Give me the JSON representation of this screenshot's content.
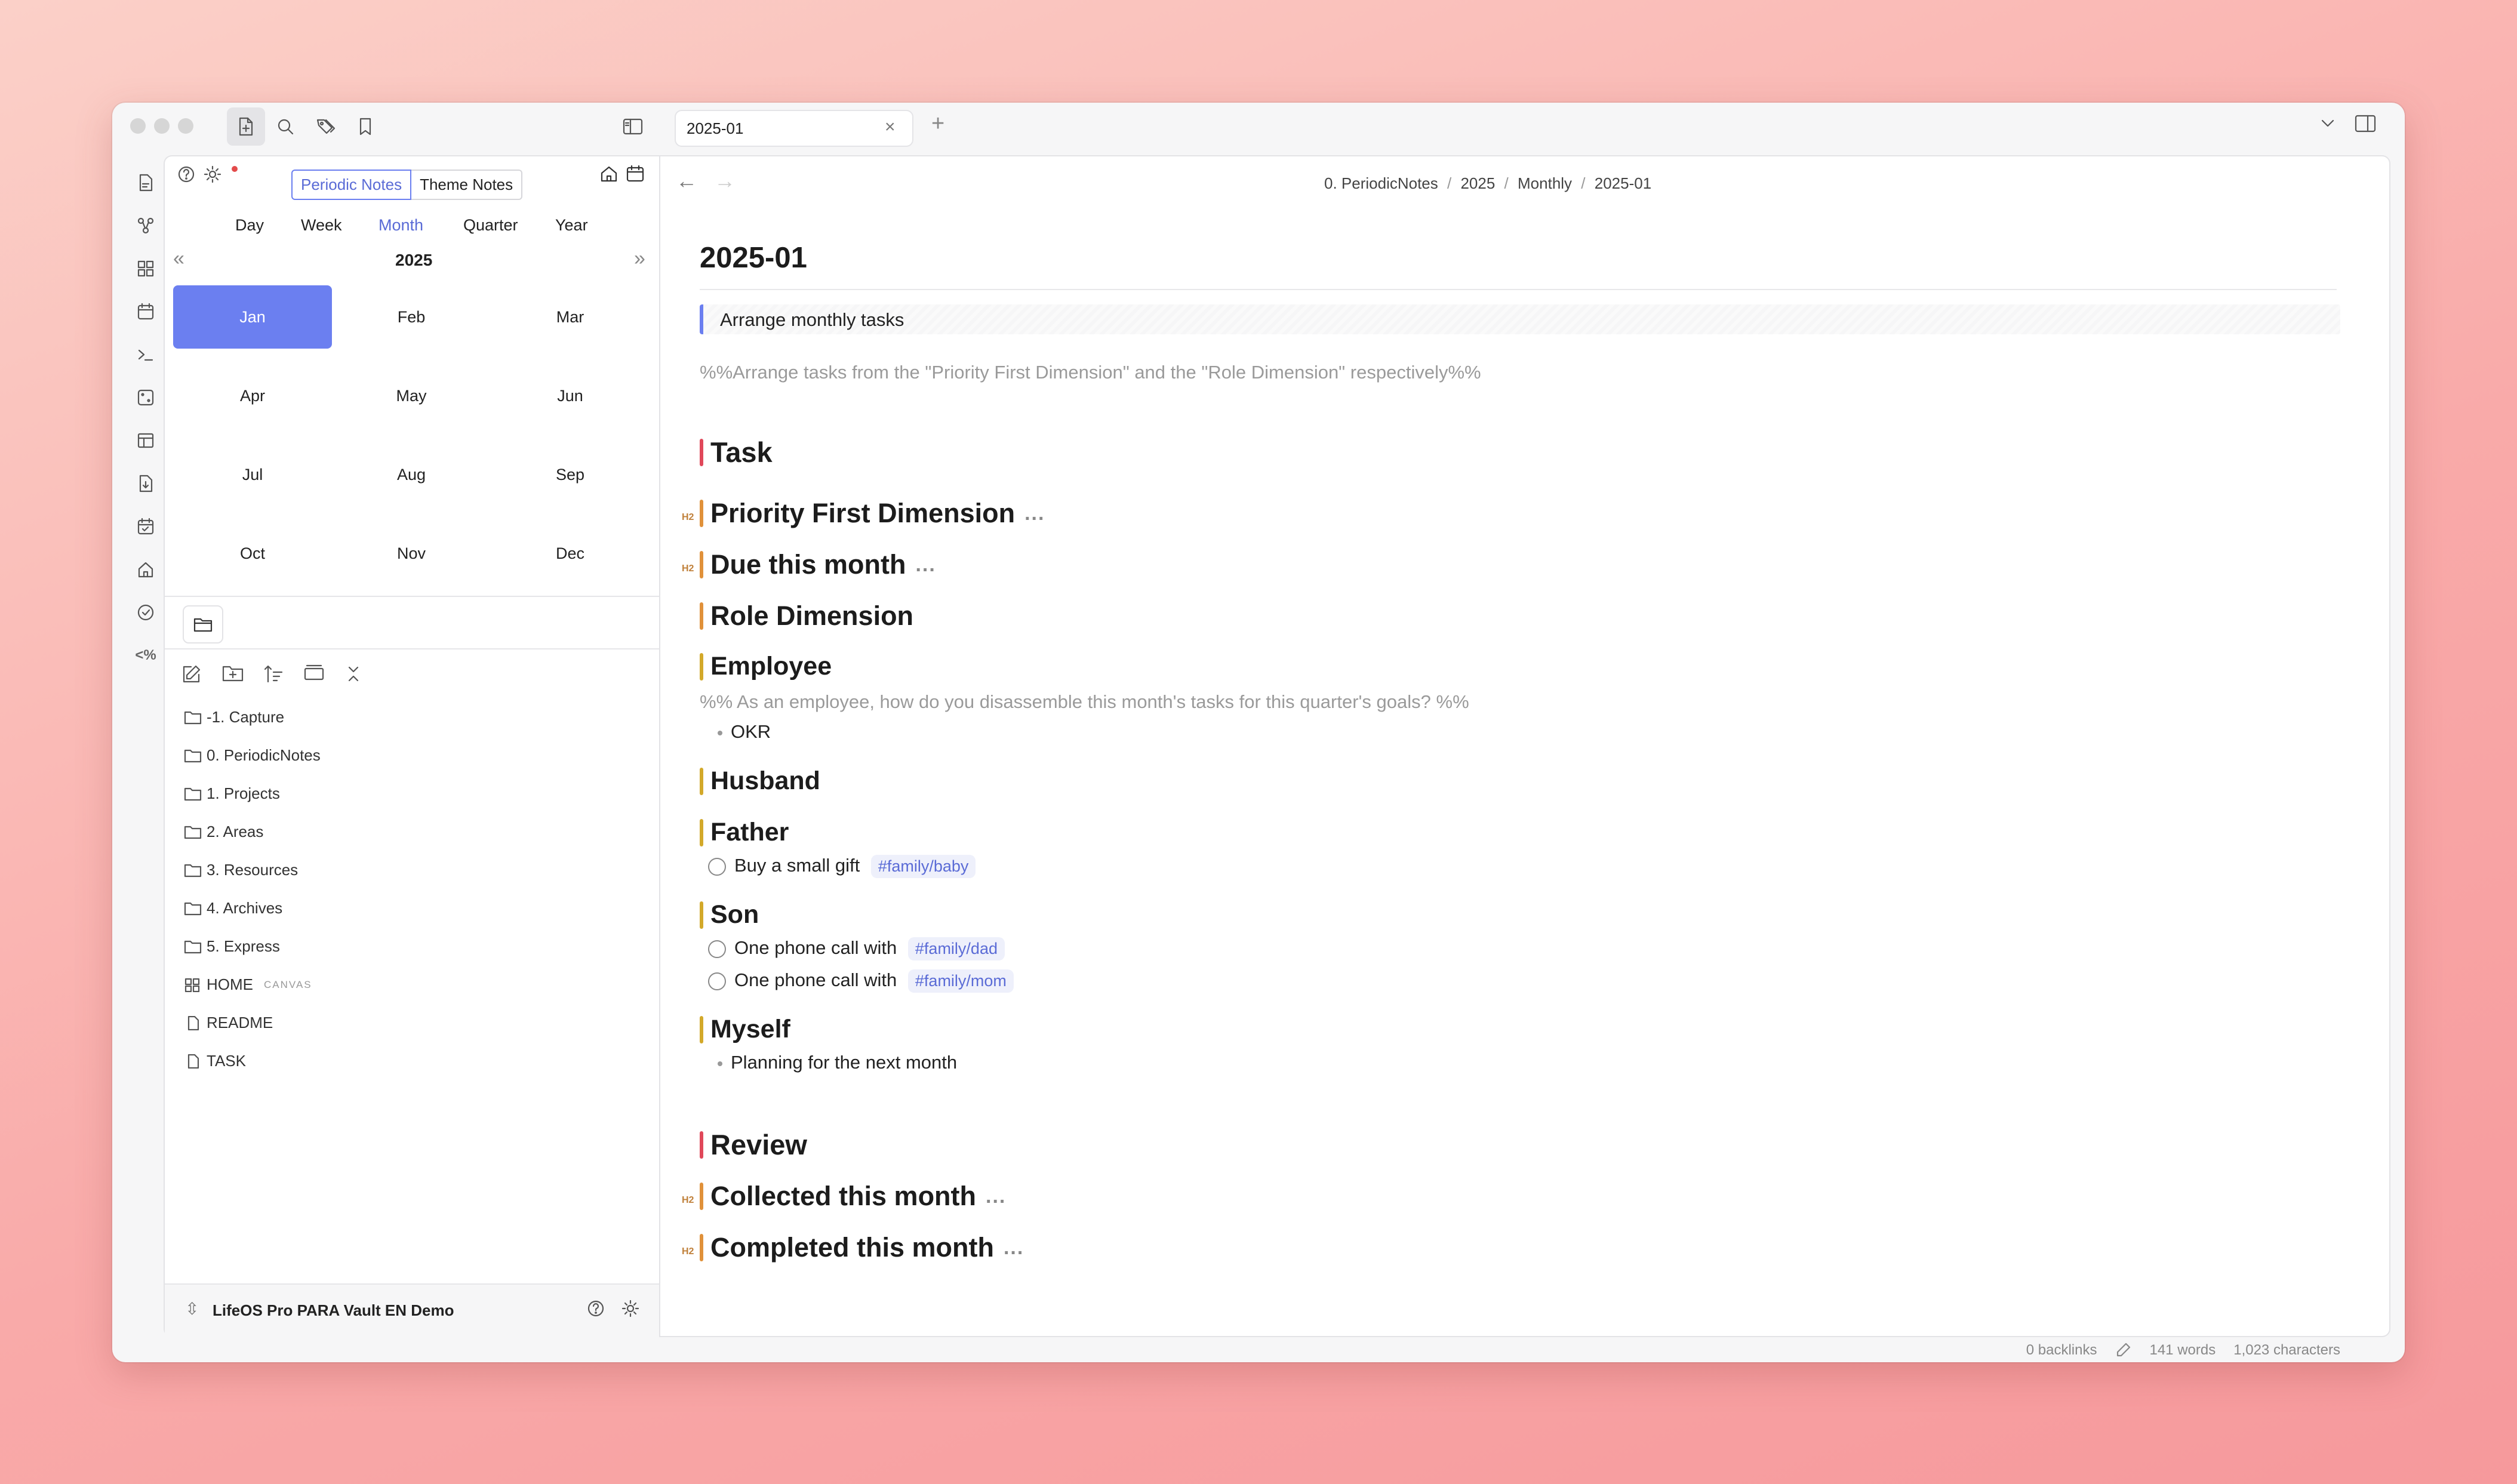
{
  "tab": {
    "title": "2025-01"
  },
  "breadcrumb": [
    "0. PeriodicNotes",
    "2025",
    "Monthly",
    "2025-01"
  ],
  "calendar": {
    "toggle": [
      "Periodic Notes",
      "Theme Notes"
    ],
    "periods": [
      "Day",
      "Week",
      "Month",
      "Quarter",
      "Year"
    ],
    "active_period": "Month",
    "year": "2025",
    "months": [
      "Jan",
      "Feb",
      "Mar",
      "Apr",
      "May",
      "Jun",
      "Jul",
      "Aug",
      "Sep",
      "Oct",
      "Nov",
      "Dec"
    ],
    "selected_month": "Jan"
  },
  "file_tree": [
    {
      "label": "-1. Capture",
      "type": "folder"
    },
    {
      "label": "0. PeriodicNotes",
      "type": "folder"
    },
    {
      "label": "1. Projects",
      "type": "folder"
    },
    {
      "label": "2. Areas",
      "type": "folder"
    },
    {
      "label": "3. Resources",
      "type": "folder"
    },
    {
      "label": "4. Archives",
      "type": "folder"
    },
    {
      "label": "5. Express",
      "type": "folder"
    },
    {
      "label": "HOME",
      "type": "canvas",
      "badge": "CANVAS"
    },
    {
      "label": "README",
      "type": "file"
    },
    {
      "label": "TASK",
      "type": "file"
    }
  ],
  "vault": {
    "name": "LifeOS Pro PARA Vault EN Demo"
  },
  "note": {
    "title": "2025-01",
    "callout": "Arrange monthly tasks",
    "comment1": "%%Arrange tasks from the \"Priority First Dimension\" and the \"Role Dimension\" respectively%%",
    "h_task": "Task",
    "h_priority": "Priority First Dimension",
    "h_due": "Due this month",
    "h_role": "Role Dimension",
    "h_employee": "Employee",
    "comment2": "%% As an employee, how do you disassemble this month's tasks for this quarter's goals? %%",
    "okr": "OKR",
    "h_husband": "Husband",
    "h_father": "Father",
    "task_gift": "Buy a small gift",
    "tag_baby": "#family/baby",
    "h_son": "Son",
    "task_call": "One phone call with",
    "tag_dad": "#family/dad",
    "tag_mom": "#family/mom",
    "h_myself": "Myself",
    "planning": "Planning for the next month",
    "h_review": "Review",
    "h_collected": "Collected this month",
    "h_completed": "Completed this month",
    "h2_label": "H2",
    "ellipsis": "..."
  },
  "status": {
    "backlinks": "0 backlinks",
    "words": "141 words",
    "chars": "1,023 characters"
  },
  "colors": {
    "accent": "#6b7ff0",
    "h1_bar": "#e0485a",
    "h_bar_orange": "#e0913a",
    "h_bar_yellow": "#d3a92a"
  }
}
